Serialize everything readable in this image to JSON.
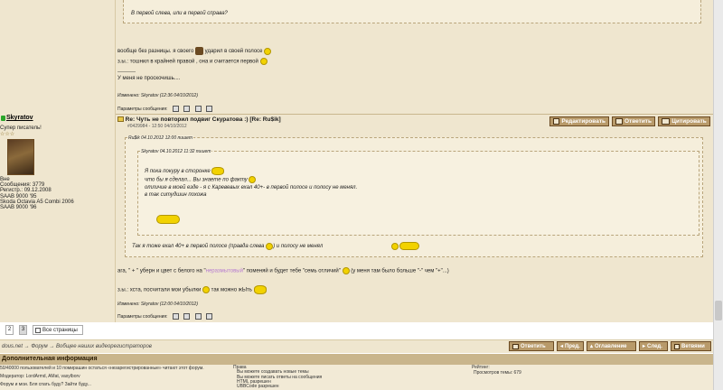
{
  "prev_post": {
    "quote_line": "В первой слева, или в первой справа?",
    "line1": "вообще без разницы. я своего",
    "line1b": "ударил в своей полосе",
    "line2": "з.ы.: тошнил в крайней правой , она и считается первой",
    "sep": "----------",
    "sig": "У меня не проскочишь....",
    "edited": "Изменено: Skyratov (12:36 04/10/2012)",
    "params": "Параметры сообщения:"
  },
  "author": {
    "name": "Skyratov",
    "rank": "Супер писатель!",
    "stars": "☆☆☆",
    "meta": [
      "Вне",
      "Сообщения: 3779",
      "Регистр.: 09.12.2008",
      "SAAB 9000 '95",
      "Skoda Octavia A5 Combi 2006",
      "SAAB 9000 '96"
    ]
  },
  "post": {
    "title": "Re: Чуть не повторил подвиг Скуратова :) [Re: Ru$ik]",
    "meta": "#0429984 - 12:50 04/10/2012",
    "buttons": {
      "edit": "Редактировать",
      "reply": "Ответить",
      "quote": "Цитировать"
    },
    "outer_quote_header": "Ru$ik 04.10.2012 12:00 пишет",
    "inner_quote_header": "Skyratov 04.10.2012 11:32 пишет",
    "inner_lines": [
      "Я пока покуру в сторонке",
      "что бы я сделал... Вы знаете по факту",
      "отличие в моей езде - я с Каревевых ехал 40+- в первой полосе и полосу не менял.",
      "в так ситудшин похожа"
    ],
    "outer_line": "Так я тоже ехал 40+ в первой полосе (правда слева",
    "outer_line_b": ") и полосу не менял",
    "body1a": "ага, \" + \" уберн и цвет с белого на \"",
    "body1_link": "неразмытовый",
    "body1b": "\" поменяй и будет тебе \"семь отличий\"",
    "body1c": "(у меня там было больше \"-\" чем \"+\"...)",
    "body2a": "з.ы.: хста, посчитали мои убылки",
    "body2b": "так можно жЫть",
    "edited": "Изменено: Skyratov (12:00 04/10/2012)",
    "params": "Параметры сообщения:"
  },
  "pager": {
    "pages": [
      "2",
      "3"
    ],
    "all": "Все страницы"
  },
  "breadcrumb": "dous.net → Форум → Вобщее наших видеорегистраторов",
  "nav": {
    "reply": "Ответить",
    "prev": "Пред.",
    "tree": "Оглавление",
    "next": "След.",
    "branches": "Ветвями"
  },
  "info": {
    "header": "Дополнительная информация",
    "col1": [
      "50/40000 пользователей и 10 помирашин остаться «незарегистрированные» читают этот форум.",
      "Модератор: LordArmd, AMat, vasylborv",
      "Форум и мои. Бля спать буду? Зайти буду..."
    ],
    "col2_title": "Права",
    "col2": [
      "Вы можете создавать новые темы",
      "Вы можете писать ответы на сообщения",
      "HTML разрешен",
      "UBBCode разрешен"
    ],
    "col3_title": "Рейтинг:",
    "col3": [
      "Просмотров темы: 679"
    ]
  }
}
